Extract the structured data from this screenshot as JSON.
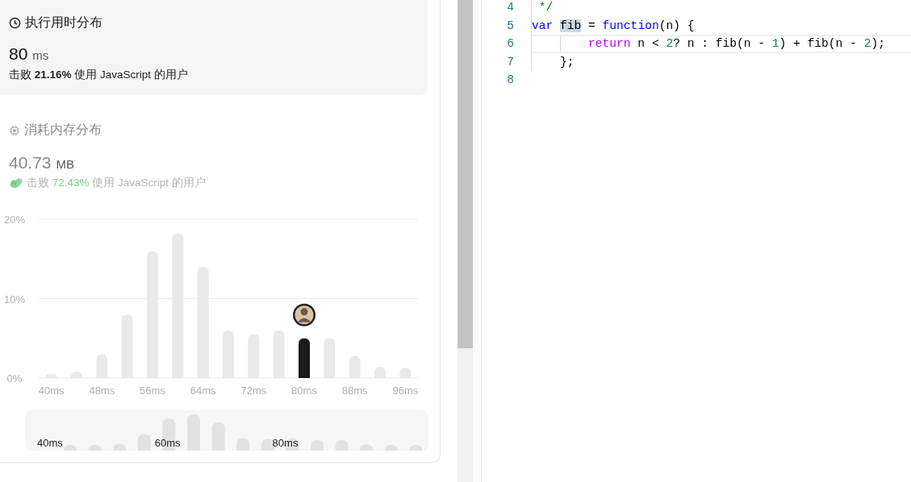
{
  "runtime": {
    "title": "执行用时分布",
    "value": "80",
    "unit": "ms",
    "beats_prefix": "击败",
    "beats_percent": "21.16%",
    "beats_suffix": "使用 JavaScript 的用户"
  },
  "memory": {
    "title": "消耗内存分布",
    "value": "40.73",
    "unit": "MB",
    "beats_prefix": "击败",
    "beats_percent": "72.43%",
    "beats_suffix": "使用 JavaScript 的用户"
  },
  "chart_data": {
    "type": "bar",
    "categories": [
      "40ms",
      null,
      "48ms",
      null,
      "56ms",
      null,
      "64ms",
      null,
      "72ms",
      null,
      "80ms",
      null,
      "88ms",
      null,
      "96ms"
    ],
    "series": [
      {
        "color": "#e9e9e9",
        "values": [
          0.5,
          0.8,
          3,
          8,
          16,
          18.2,
          14,
          6,
          5.5,
          6,
          null,
          5,
          2.8,
          1.4,
          1.3
        ]
      },
      {
        "color": "#1a1a1a",
        "values": [
          null,
          null,
          null,
          null,
          null,
          null,
          null,
          null,
          null,
          null,
          5,
          null,
          null,
          null,
          null
        ]
      }
    ],
    "ylim": [
      0,
      20
    ],
    "yticks": [
      {
        "value": 0,
        "label": "0%"
      },
      {
        "value": 10,
        "label": "10%"
      },
      {
        "value": 20,
        "label": "20%"
      }
    ]
  },
  "navigator": {
    "labels": [
      "40ms",
      "60ms",
      "80ms"
    ]
  },
  "editor": {
    "lines": [
      {
        "number": "4",
        "current": false,
        "tokens": [
          {
            "kind": "comment",
            "text": " */"
          }
        ]
      },
      {
        "number": "5",
        "current": false,
        "tokens": [
          {
            "kind": "keyword",
            "text": "var "
          },
          {
            "kind": "match",
            "text": "fib"
          },
          {
            "kind": "plain",
            "text": " = "
          },
          {
            "kind": "keyword",
            "text": "function"
          },
          {
            "kind": "plain",
            "text": "(n) {"
          }
        ]
      },
      {
        "number": "6",
        "current": true,
        "tokens": [
          {
            "kind": "control",
            "text": "        return"
          },
          {
            "kind": "plain",
            "text": " n < "
          },
          {
            "kind": "number",
            "text": "2"
          },
          {
            "kind": "plain",
            "text": "? n : fib(n - "
          },
          {
            "kind": "number",
            "text": "1"
          },
          {
            "kind": "plain",
            "text": ") + fib(n - "
          },
          {
            "kind": "number",
            "text": "2"
          },
          {
            "kind": "plain",
            "text": ");"
          }
        ]
      },
      {
        "number": "7",
        "current": false,
        "tokens": [
          {
            "kind": "plain",
            "text": "    };"
          }
        ]
      },
      {
        "number": "8",
        "current": false
      }
    ]
  }
}
